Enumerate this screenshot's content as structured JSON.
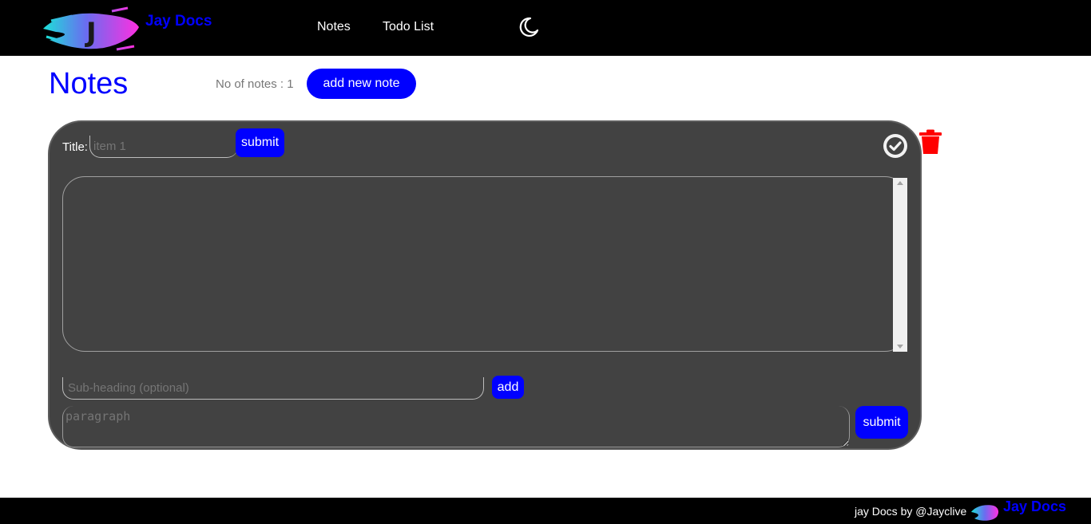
{
  "header": {
    "logo_letter": "J",
    "brand": "Jay Docs",
    "nav": [
      {
        "label": "Notes"
      },
      {
        "label": "Todo List"
      }
    ],
    "theme_toggle_icon": "moon-icon"
  },
  "page": {
    "title": "Notes",
    "note_count": "No of notes : 1",
    "add_button": "add new note"
  },
  "note": {
    "title_label": "Title:",
    "title_placeholder": "item 1",
    "title_submit": "submit",
    "body_value": "",
    "subheading_placeholder": "Sub-heading (optional)",
    "add_label": "add",
    "paragraph_placeholder": "paragraph",
    "paragraph_submit": "submit",
    "check_icon": "check-circle-icon",
    "delete_icon": "trash-icon"
  },
  "footer": {
    "text": "jay Docs by @Jayclive",
    "brand": "Jay Docs"
  },
  "colors": {
    "accent": "#0000ff",
    "card": "#424242",
    "delete": "#ff0000",
    "header_bg": "#000000"
  }
}
